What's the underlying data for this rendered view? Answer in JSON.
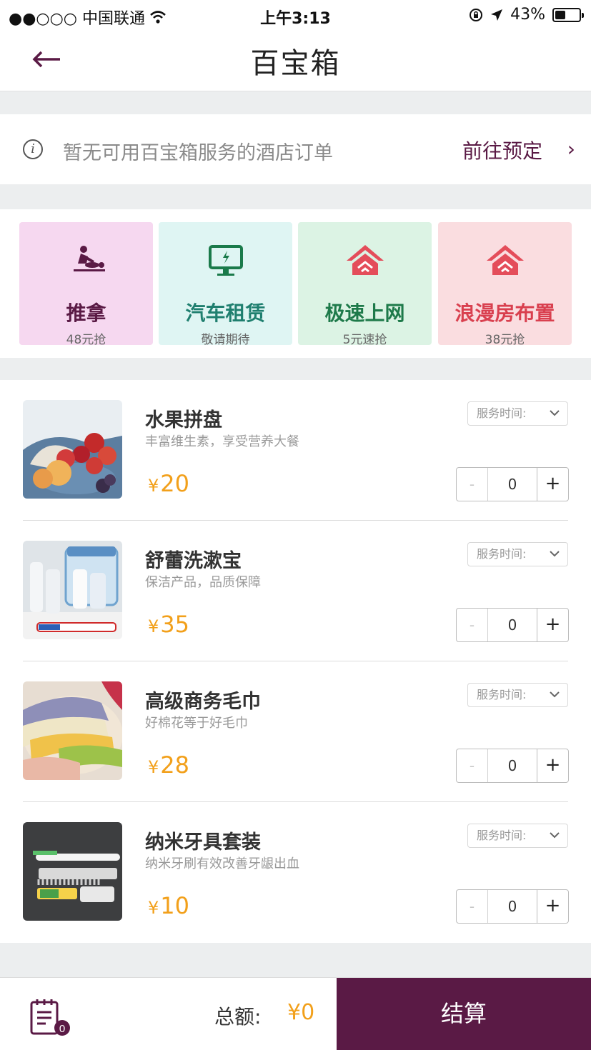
{
  "status_bar": {
    "carrier": "●●○○○ 中国联通",
    "time": "上午3:13",
    "battery": "43%",
    "battery_level": 0.43
  },
  "nav": {
    "back_glyph": "←",
    "title": "百宝箱"
  },
  "notice": {
    "info_glyph": "i",
    "message": "暂无可用百宝箱服务的酒店订单",
    "link": "前往预定",
    "chevron": "›"
  },
  "services": [
    {
      "icon": "massage-icon",
      "name": "推拿",
      "sub": "48元抢",
      "bg": "#f6d8f0",
      "color": "#5a1a45",
      "icon_color": "#5a1a45"
    },
    {
      "icon": "monitor-icon",
      "name": "汽车租赁",
      "sub": "敬请期待",
      "bg": "#dff5f3",
      "color": "#1f7f6f",
      "icon_color": "#1a7a4a"
    },
    {
      "icon": "wifi-house-icon",
      "name": "极速上网",
      "sub": "5元速抢",
      "bg": "#dcf3e4",
      "color": "#1e7a4a",
      "icon_color": "#e44d5a"
    },
    {
      "icon": "house-icon",
      "name": "浪漫房布置",
      "sub": "38元抢",
      "bg": "#fadde0",
      "color": "#d9404f",
      "icon_color": "#e44d5a"
    }
  ],
  "products": [
    {
      "title": "水果拼盘",
      "desc": "丰富维生素，享受营养大餐",
      "currency": "¥",
      "price": "20",
      "service_time": "服务时间:",
      "qty": "0",
      "minus": "-",
      "plus": "+",
      "image": "fruit-platter"
    },
    {
      "title": "舒蕾洗漱宝",
      "desc": "保洁产品，品质保障",
      "currency": "¥",
      "price": "35",
      "service_time": "服务时间:",
      "qty": "0",
      "minus": "-",
      "plus": "+",
      "image": "toiletries"
    },
    {
      "title": "高级商务毛巾",
      "desc": "好棉花等于好毛巾",
      "currency": "¥",
      "price": "28",
      "service_time": "服务时间:",
      "qty": "0",
      "minus": "-",
      "plus": "+",
      "image": "towels"
    },
    {
      "title": "纳米牙具套装",
      "desc": "纳米牙刷有效改善牙龈出血",
      "currency": "¥",
      "price": "10",
      "service_time": "服务时间:",
      "qty": "0",
      "minus": "-",
      "plus": "+",
      "image": "toothbrush-kit"
    }
  ],
  "bottom": {
    "cart_count": "0",
    "total_label": "总额:",
    "total_value": "¥0",
    "checkout": "结算"
  },
  "colors": {
    "brand": "#5a1a45",
    "price": "#f2a01b",
    "gap": "#eceeef"
  }
}
